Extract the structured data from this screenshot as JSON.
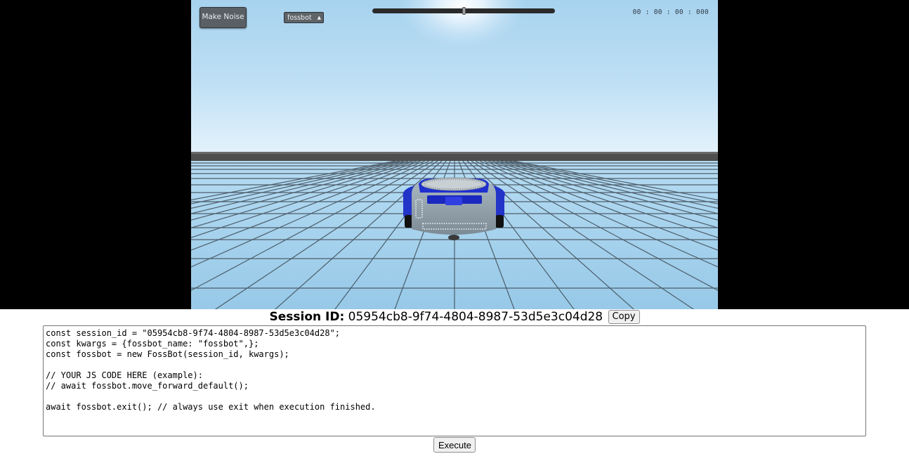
{
  "simulator": {
    "make_noise_label": "Make Noise",
    "robot_select": {
      "selected": "fossbot"
    },
    "timeline_progress": 0.5,
    "clock": "00 : 00 : 00 : 000"
  },
  "session": {
    "label": "Session ID:",
    "id": "05954cb8-9f74-4804-8987-53d5e3c04d28",
    "copy_label": "Copy"
  },
  "editor": {
    "lines": [
      "const session_id = \"05954cb8-9f74-4804-8987-53d5e3c04d28\";",
      "const kwargs = {fossbot_name: \"fossbot\",};",
      "const fossbot = new FossBot(session_id, kwargs);",
      "",
      "// YOUR JS CODE HERE (example):",
      "// await fossbot.move_forward_default();",
      "",
      "await fossbot.exit(); // always use exit when execution finished."
    ]
  },
  "execute_label": "Execute",
  "colors": {
    "sky_top": "#a9d3ef",
    "sky_bottom": "#dff0fb",
    "floor": "#a4d1ec",
    "wall": "#545454",
    "robot_blue": "#1f2fc8",
    "robot_body": "#8f9ea8"
  }
}
